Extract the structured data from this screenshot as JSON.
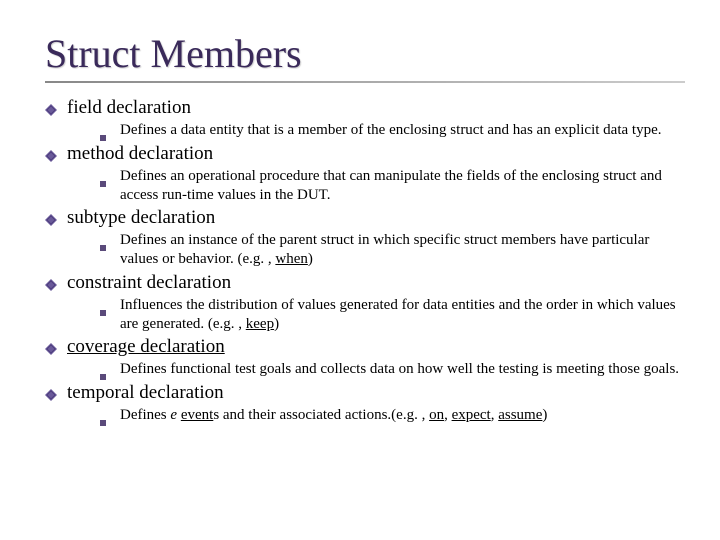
{
  "title": "Struct Members",
  "items": [
    {
      "heading": "field declaration",
      "heading_underlined": false,
      "desc_pre": "Defines a data entity that is a member of the enclosing struct and has an explicit data type.",
      "desc_eg": "",
      "desc_kw": ""
    },
    {
      "heading": "method declaration",
      "heading_underlined": false,
      "desc_pre": "Defines an operational procedure that can manipulate the fields of the enclosing struct and access run-time values in the DUT.",
      "desc_eg": "",
      "desc_kw": ""
    },
    {
      "heading": "subtype declaration",
      "heading_underlined": false,
      "desc_pre": "Defines an instance of the parent struct in which specific struct members have particular values or behavior. (e.g. , ",
      "desc_eg": "",
      "desc_kw": "when",
      "desc_post": ")"
    },
    {
      "heading": "constraint declaration",
      "heading_underlined": false,
      "desc_pre": "Influences the distribution of values generated for data entities and the order in which values are generated. (e.g. , ",
      "desc_eg": "",
      "desc_kw": "keep",
      "desc_post": ")"
    },
    {
      "heading": "coverage declaration",
      "heading_underlined": true,
      "desc_pre": "Defines functional test goals and collects data on how well the testing is meeting those goals.",
      "desc_eg": "",
      "desc_kw": ""
    },
    {
      "heading": "temporal declaration",
      "heading_underlined": false,
      "desc_pre": "Defines ",
      "desc_italic_pre": "e ",
      "desc_mid": "event",
      "desc_mid_under": true,
      "desc_after": "s and their associated actions.(e.g. ,  ",
      "desc_kw_list": [
        "on",
        "expect",
        "assume"
      ],
      "desc_post": ")"
    }
  ]
}
